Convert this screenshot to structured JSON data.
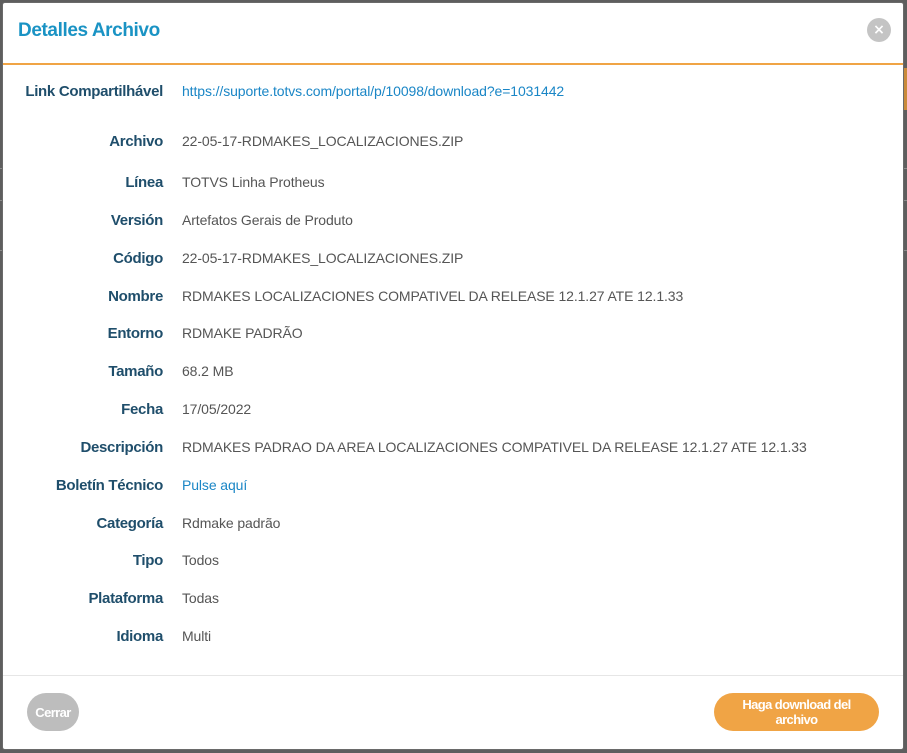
{
  "modal": {
    "title": "Detalles Archivo",
    "close_icon": "×"
  },
  "details": [
    {
      "label": "Link Compartilhável",
      "value": "https://suporte.totvs.com/portal/p/10098/download?e=1031442",
      "is_link": true
    },
    {
      "label": "Archivo",
      "value": "22-05-17-RDMAKES_LOCALIZACIONES.ZIP",
      "is_link": false
    },
    {
      "label": "Línea",
      "value": "TOTVS Linha Protheus",
      "is_link": false
    },
    {
      "label": "Versión",
      "value": "Artefatos Gerais de Produto",
      "is_link": false
    },
    {
      "label": "Código",
      "value": "22-05-17-RDMAKES_LOCALIZACIONES.ZIP",
      "is_link": false
    },
    {
      "label": "Nombre",
      "value": "RDMAKES LOCALIZACIONES COMPATIVEL DA RELEASE 12.1.27 ATE 12.1.33",
      "is_link": false
    },
    {
      "label": "Entorno",
      "value": "RDMAKE PADRÃO",
      "is_link": false
    },
    {
      "label": "Tamaño",
      "value": "68.2 MB",
      "is_link": false
    },
    {
      "label": "Fecha",
      "value": "17/05/2022",
      "is_link": false
    },
    {
      "label": "Descripción",
      "value": "RDMAKES PADRAO DA AREA LOCALIZACIONES COMPATIVEL DA RELEASE 12.1.27 ATE 12.1.33",
      "is_link": false
    },
    {
      "label": "Boletín Técnico",
      "value": "Pulse aquí",
      "is_link": true
    },
    {
      "label": "Categoría",
      "value": "Rdmake padrão",
      "is_link": false
    },
    {
      "label": "Tipo",
      "value": "Todos",
      "is_link": false
    },
    {
      "label": "Plataforma",
      "value": "Todas",
      "is_link": false
    },
    {
      "label": "Idioma",
      "value": "Multi",
      "is_link": false
    }
  ],
  "footer": {
    "close_label": "Cerrar",
    "download_label": "Haga download del archivo"
  },
  "colors": {
    "title": "#1a93c4",
    "accent": "#f0a445",
    "label": "#1f4e6b",
    "link": "#1a86c6"
  }
}
